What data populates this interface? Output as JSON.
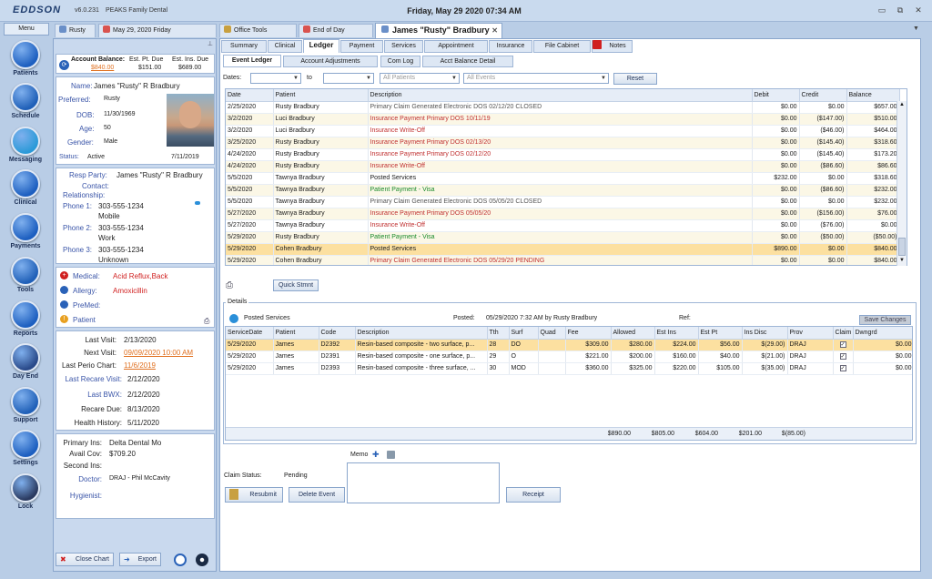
{
  "app": {
    "logo": "EDDSON",
    "version": "v6.0.231",
    "practice": "PEAKS Family Dental",
    "datetime": "Friday, May 29 2020 07:34 AM",
    "menu": "Menu"
  },
  "tabs": [
    {
      "label": "Rusty"
    },
    {
      "label": "May 29, 2020 Friday"
    },
    {
      "label": "Office Tools"
    },
    {
      "label": "End of Day"
    }
  ],
  "active_tab": "James \"Rusty\" Bradbury",
  "nav": [
    "Patients",
    "Schedule",
    "Messaging",
    "Clinical",
    "Payments",
    "Tools",
    "Reports",
    "Day End",
    "Support",
    "Settings",
    "Lock"
  ],
  "account": {
    "title": "Account Balance:",
    "balance": "$840.00",
    "est_pt_label": "Est. Pt. Due",
    "est_pt": "$151.00",
    "est_ins_label": "Est. Ins. Due",
    "est_ins": "$689.00"
  },
  "patient": {
    "name_label": "Name:",
    "name": "James \"Rusty\" R Bradbury",
    "preferred_label": "Preferred:",
    "preferred": "Rusty",
    "dob_label": "DOB:",
    "dob": "11/30/1969",
    "age_label": "Age:",
    "age": "50",
    "gender_label": "Gender:",
    "gender": "Male",
    "status_label": "Status:",
    "status": "Active",
    "status_date": "7/11/2019"
  },
  "resp": {
    "resp_label": "Resp Party:",
    "resp": "James \"Rusty\" R Bradbury",
    "contact_label": "Contact:",
    "relationship_label": "Relationship:",
    "phone1_label": "Phone 1:",
    "phone1": "303-555-1234",
    "phone1_type": "Mobile",
    "phone2_label": "Phone 2:",
    "phone2": "303-555-1234",
    "phone2_type": "Work",
    "phone3_label": "Phone 3:",
    "phone3": "303-555-1234",
    "phone3_type": "Unknown"
  },
  "alerts": {
    "medical_label": "Medical:",
    "medical": "Acid Reflux,Back",
    "allergy_label": "Allergy:",
    "allergy": "Amoxicillin",
    "premed_label": "PreMed:",
    "patient_label": "Patient"
  },
  "visits": {
    "last_label": "Last Visit:",
    "last": "2/13/2020",
    "next_label": "Next Visit:",
    "next": "09/09/2020 10:00 AM",
    "perio_label": "Last Perio Chart:",
    "perio": "11/6/2019",
    "recare_label": "Last Recare Visit:",
    "recare": "2/12/2020",
    "bwx_label": "Last BWX:",
    "bwx": "2/12/2020",
    "recare_date_label": "Recare Due:",
    "recare_date": "8/13/2020",
    "health_label": "Health History:",
    "health": "5/11/2020"
  },
  "insurance": {
    "primary_label": "Primary Ins:",
    "primary": "Delta Dental Mo",
    "avail_label": "Avail Cov:",
    "avail": "$709.20",
    "second_label": "Second Ins:",
    "doctor_label": "Doctor:",
    "doctor": "DRAJ - Phil McCavity",
    "hygienist_label": "Hygienist:"
  },
  "footer": {
    "close": "Close Chart",
    "export": "Export"
  },
  "subtabs": [
    "Summary",
    "Clinical",
    "Ledger",
    "Payment",
    "Services",
    "Appointment",
    "Insurance",
    "File Cabinet",
    "Notes"
  ],
  "sub2tabs": [
    "Event Ledger",
    "Account Adjustments",
    "Com Log",
    "Acct Balance Detail"
  ],
  "filters": {
    "dates_label": "Dates:",
    "to_label": "to",
    "patients": "All Patients",
    "events": "All Events",
    "reset": "Reset"
  },
  "ledger": {
    "columns": [
      "Date",
      "Patient",
      "Description",
      "Debit",
      "Credit",
      "Balance"
    ],
    "rows": [
      [
        "2/25/2020",
        "Rusty Bradbury",
        "Primary Claim Generated Electronic DOS 02/12/20 CLOSED",
        "$0.00",
        "$0.00",
        "$657.00",
        "g"
      ],
      [
        "3/2/2020",
        "Luci Bradbury",
        "Insurance Payment Primary DOS 10/11/19",
        "$0.00",
        "($147.00)",
        "$510.00",
        "r"
      ],
      [
        "3/2/2020",
        "Luci Bradbury",
        "Insurance Write-Off",
        "$0.00",
        "($46.00)",
        "$464.00",
        "r"
      ],
      [
        "3/25/2020",
        "Rusty Bradbury",
        "Insurance Payment Primary DOS 02/13/20",
        "$0.00",
        "($145.40)",
        "$318.60",
        "r"
      ],
      [
        "4/24/2020",
        "Rusty Bradbury",
        "Insurance Payment Primary DOS 02/12/20",
        "$0.00",
        "($145.40)",
        "$173.20",
        "r"
      ],
      [
        "4/24/2020",
        "Rusty Bradbury",
        "Insurance Write-Off",
        "$0.00",
        "($86.60)",
        "$86.60",
        "r"
      ],
      [
        "5/5/2020",
        "Tawnya Bradbury",
        "Posted Services",
        "$232.00",
        "$0.00",
        "$318.60",
        "n"
      ],
      [
        "5/5/2020",
        "Tawnya Bradbury",
        "Patient Payment - Visa",
        "$0.00",
        "($86.60)",
        "$232.00",
        "gr"
      ],
      [
        "5/5/2020",
        "Tawnya Bradbury",
        "Primary Claim Generated Electronic DOS 05/05/20 CLOSED",
        "$0.00",
        "$0.00",
        "$232.00",
        "g"
      ],
      [
        "5/27/2020",
        "Tawnya Bradbury",
        "Insurance Payment Primary DOS 05/05/20",
        "$0.00",
        "($156.00)",
        "$76.00",
        "r"
      ],
      [
        "5/27/2020",
        "Tawnya Bradbury",
        "Insurance Write-Off",
        "$0.00",
        "($76.00)",
        "$0.00",
        "r"
      ],
      [
        "5/29/2020",
        "Rusty Bradbury",
        "Patient Payment - Visa",
        "$0.00",
        "($50.00)",
        "($50.00)",
        "gr"
      ],
      [
        "5/29/2020",
        "Cohen Bradbury",
        "Posted Services",
        "$890.00",
        "$0.00",
        "$840.00",
        "n"
      ],
      [
        "5/29/2020",
        "Cohen Bradbury",
        "Primary Claim Generated Electronic DOS 05/29/20 PENDING",
        "$0.00",
        "$0.00",
        "$840.00",
        "r"
      ]
    ]
  },
  "quick_stmt": "Quick Stmnt",
  "details": {
    "title": "Details",
    "posted_services": "Posted Services",
    "posted_label": "Posted:",
    "posted": "05/29/2020 7:32 AM by Rusty Bradbury",
    "ref_label": "Ref:",
    "save": "Save Changes",
    "columns": [
      "ServiceDate",
      "Patient",
      "Code",
      "Description",
      "Tth",
      "Surf",
      "Quad",
      "Fee",
      "Allowed",
      "Est Ins",
      "Est Pt",
      "Ins Disc",
      "Prov",
      "Claim",
      "Dwngrd"
    ],
    "rows": [
      [
        "5/29/2020",
        "James",
        "D2392",
        "Resin-based composite - two surface, p...",
        "28",
        "DO",
        "",
        "$309.00",
        "$280.00",
        "$224.00",
        "$56.00",
        "$(29.00)",
        "DRAJ",
        "✓",
        "$0.00"
      ],
      [
        "5/29/2020",
        "James",
        "D2391",
        "Resin-based composite - one surface, p...",
        "29",
        "O",
        "",
        "$221.00",
        "$200.00",
        "$160.00",
        "$40.00",
        "$(21.00)",
        "DRAJ",
        "✓",
        "$0.00"
      ],
      [
        "5/29/2020",
        "James",
        "D2393",
        "Resin-based composite - three surface, ...",
        "30",
        "MOD",
        "",
        "$360.00",
        "$325.00",
        "$220.00",
        "$105.00",
        "$(35.00)",
        "DRAJ",
        "✓",
        "$0.00"
      ]
    ],
    "totals": {
      "fee": "$890.00",
      "allowed": "$805.00",
      "est_ins": "$604.00",
      "est_pt": "$201.00",
      "ins_disc": "$(85.00)"
    }
  },
  "claim": {
    "status_label": "Claim Status:",
    "status": "Pending",
    "memo_label": "Memo",
    "resubmit": "Resubmit",
    "delete": "Delete Event",
    "receipt": "Receipt"
  }
}
